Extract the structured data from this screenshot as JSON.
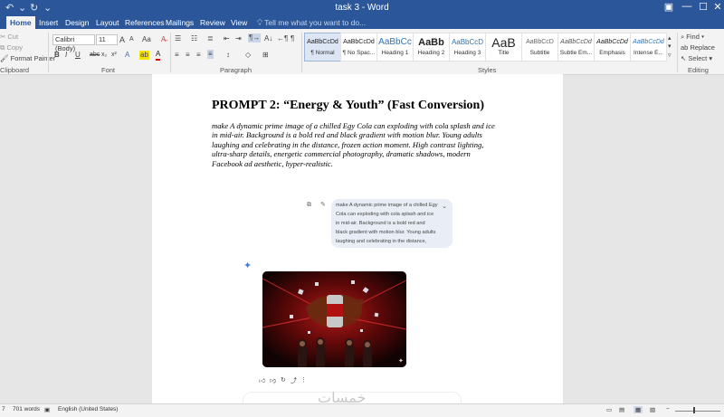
{
  "window": {
    "title": "task 3 - Word",
    "undo_icon": "undo-icon",
    "redo_icon": "redo-icon"
  },
  "window_controls": {
    "options": "▣",
    "minimize": "—",
    "maximize": "☐",
    "close": "✕"
  },
  "tabs": [
    "Home",
    "Insert",
    "Design",
    "Layout",
    "References",
    "Mailings",
    "Review",
    "View"
  ],
  "tell_me": "Tell me what you want to do...",
  "clipboard": {
    "cut": "Cut",
    "copy": "Copy",
    "format_painter": "Format Painter",
    "label": "Clipboard"
  },
  "font": {
    "name": "Calibri (Body)",
    "size": "11",
    "label": "Font",
    "grow": "A",
    "shrink": "A",
    "aa": "Aa",
    "bold": "B",
    "italic": "I",
    "underline": "U",
    "strike": "abc",
    "subscript": "x₂",
    "superscript": "x²"
  },
  "paragraph": {
    "label": "Paragraph",
    "pilcrow": "¶"
  },
  "styles": {
    "label": "Styles",
    "items": [
      {
        "preview": "AaBbCcDd",
        "name": "¶ Normal"
      },
      {
        "preview": "AaBbCcDd",
        "name": "¶ No Spac..."
      },
      {
        "preview": "AaBbCc",
        "name": "Heading 1"
      },
      {
        "preview": "AaBb",
        "name": "Heading 2"
      },
      {
        "preview": "AaBbCcD",
        "name": "Heading 3"
      },
      {
        "preview": "AaB",
        "name": "Title"
      },
      {
        "preview": "AaBbCcD",
        "name": "Subtitle"
      },
      {
        "preview": "AaBbCcDd",
        "name": "Subtle Em..."
      },
      {
        "preview": "AaBbCcDd",
        "name": "Emphasis"
      },
      {
        "preview": "AaBbCcDd",
        "name": "Intense E..."
      }
    ]
  },
  "editing": {
    "find": "Find",
    "replace": "Replace",
    "select": "Select",
    "label": "Editing"
  },
  "document": {
    "title": "PROMPT 2: “Energy & Youth” (Fast Conversion)",
    "body": "make A dynamic prime image of a chilled Egy Cola can exploding with cola splash and ice in mid-air. Background is a bold red and black gradient with motion blur. Young adults laughing and celebrating in the distance, frozen action moment. High contrast lighting, ultra-sharp details, energetic commercial photography, dramatic shadows, modern Facebook ad aesthetic, hyper-realistic.",
    "chat_bubble": "make A dynamic prime image of a chilled Egy Cola can exploding with cola splash and ice in mid-air. Background is a bold red and black gradient with motion blur. Young adults laughing and celebrating in the distance, frozen action moment. High contrast lighting,..."
  },
  "status": {
    "page_fragment": "7",
    "words": "701 words",
    "language": "English (United States)"
  },
  "watermark": "خمسات",
  "colors": {
    "ribbon_blue": "#2b579a",
    "highlight": "#f7e400",
    "font_color": "#d40000",
    "gemini_star": "#4a7de0"
  }
}
